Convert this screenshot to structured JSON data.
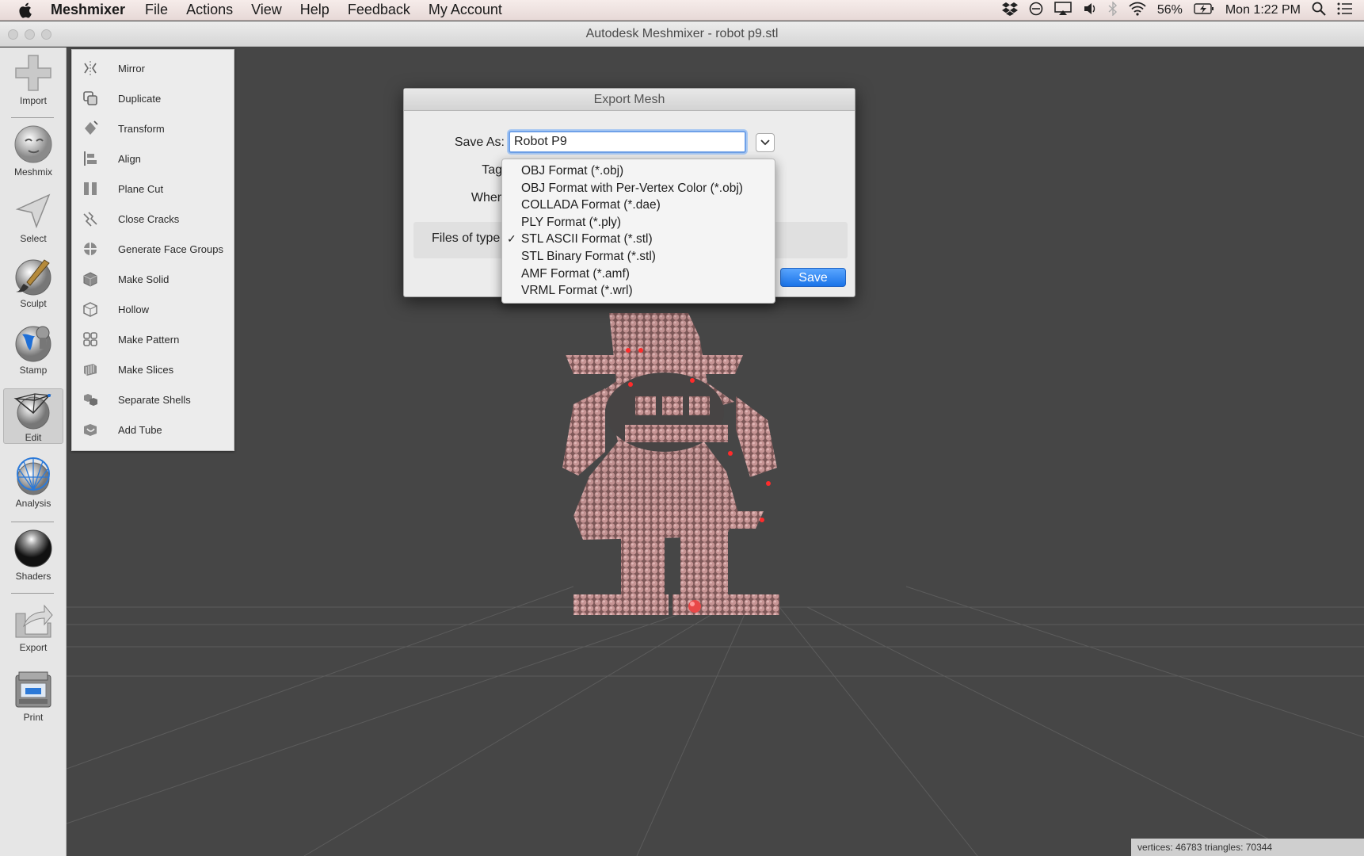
{
  "menubar": {
    "app_name": "Meshmixer",
    "items": [
      "File",
      "Actions",
      "View",
      "Help",
      "Feedback",
      "My Account"
    ],
    "battery": "56%",
    "clock": "Mon 1:22 PM"
  },
  "window": {
    "title": "Autodesk Meshmixer - robot p9.stl"
  },
  "toolbar": {
    "import": "Import",
    "meshmix": "Meshmix",
    "select": "Select",
    "sculpt": "Sculpt",
    "stamp": "Stamp",
    "edit": "Edit",
    "analysis": "Analysis",
    "shaders": "Shaders",
    "export": "Export",
    "print": "Print"
  },
  "edit_panel": {
    "items": [
      "Mirror",
      "Duplicate",
      "Transform",
      "Align",
      "Plane Cut",
      "Close Cracks",
      "Generate Face Groups",
      "Make Solid",
      "Hollow",
      "Make Pattern",
      "Make Slices",
      "Separate Shells",
      "Add Tube"
    ]
  },
  "dialog": {
    "title": "Export Mesh",
    "save_as_label": "Save As:",
    "save_as_value": "Robot P9",
    "tags_label": "Tags",
    "where_label": "Where",
    "files_of_type_label": "Files of type",
    "save_button": "Save"
  },
  "format_dropdown": {
    "options": [
      "OBJ Format (*.obj)",
      "OBJ Format with Per-Vertex Color (*.obj)",
      "COLLADA Format (*.dae)",
      "PLY Format (*.ply)",
      "STL ASCII Format (*.stl)",
      "STL Binary Format (*.stl)",
      "AMF Format (*.amf)",
      "VRML Format (*.wrl)"
    ],
    "selected": "STL ASCII Format (*.stl)",
    "checkmark": "✓"
  },
  "status": {
    "mesh_info": "vertices: 46783 triangles: 70344"
  },
  "colors": {
    "mesh": "#c98f8f",
    "viewport": "#464646",
    "accent": "#1a73e8"
  }
}
